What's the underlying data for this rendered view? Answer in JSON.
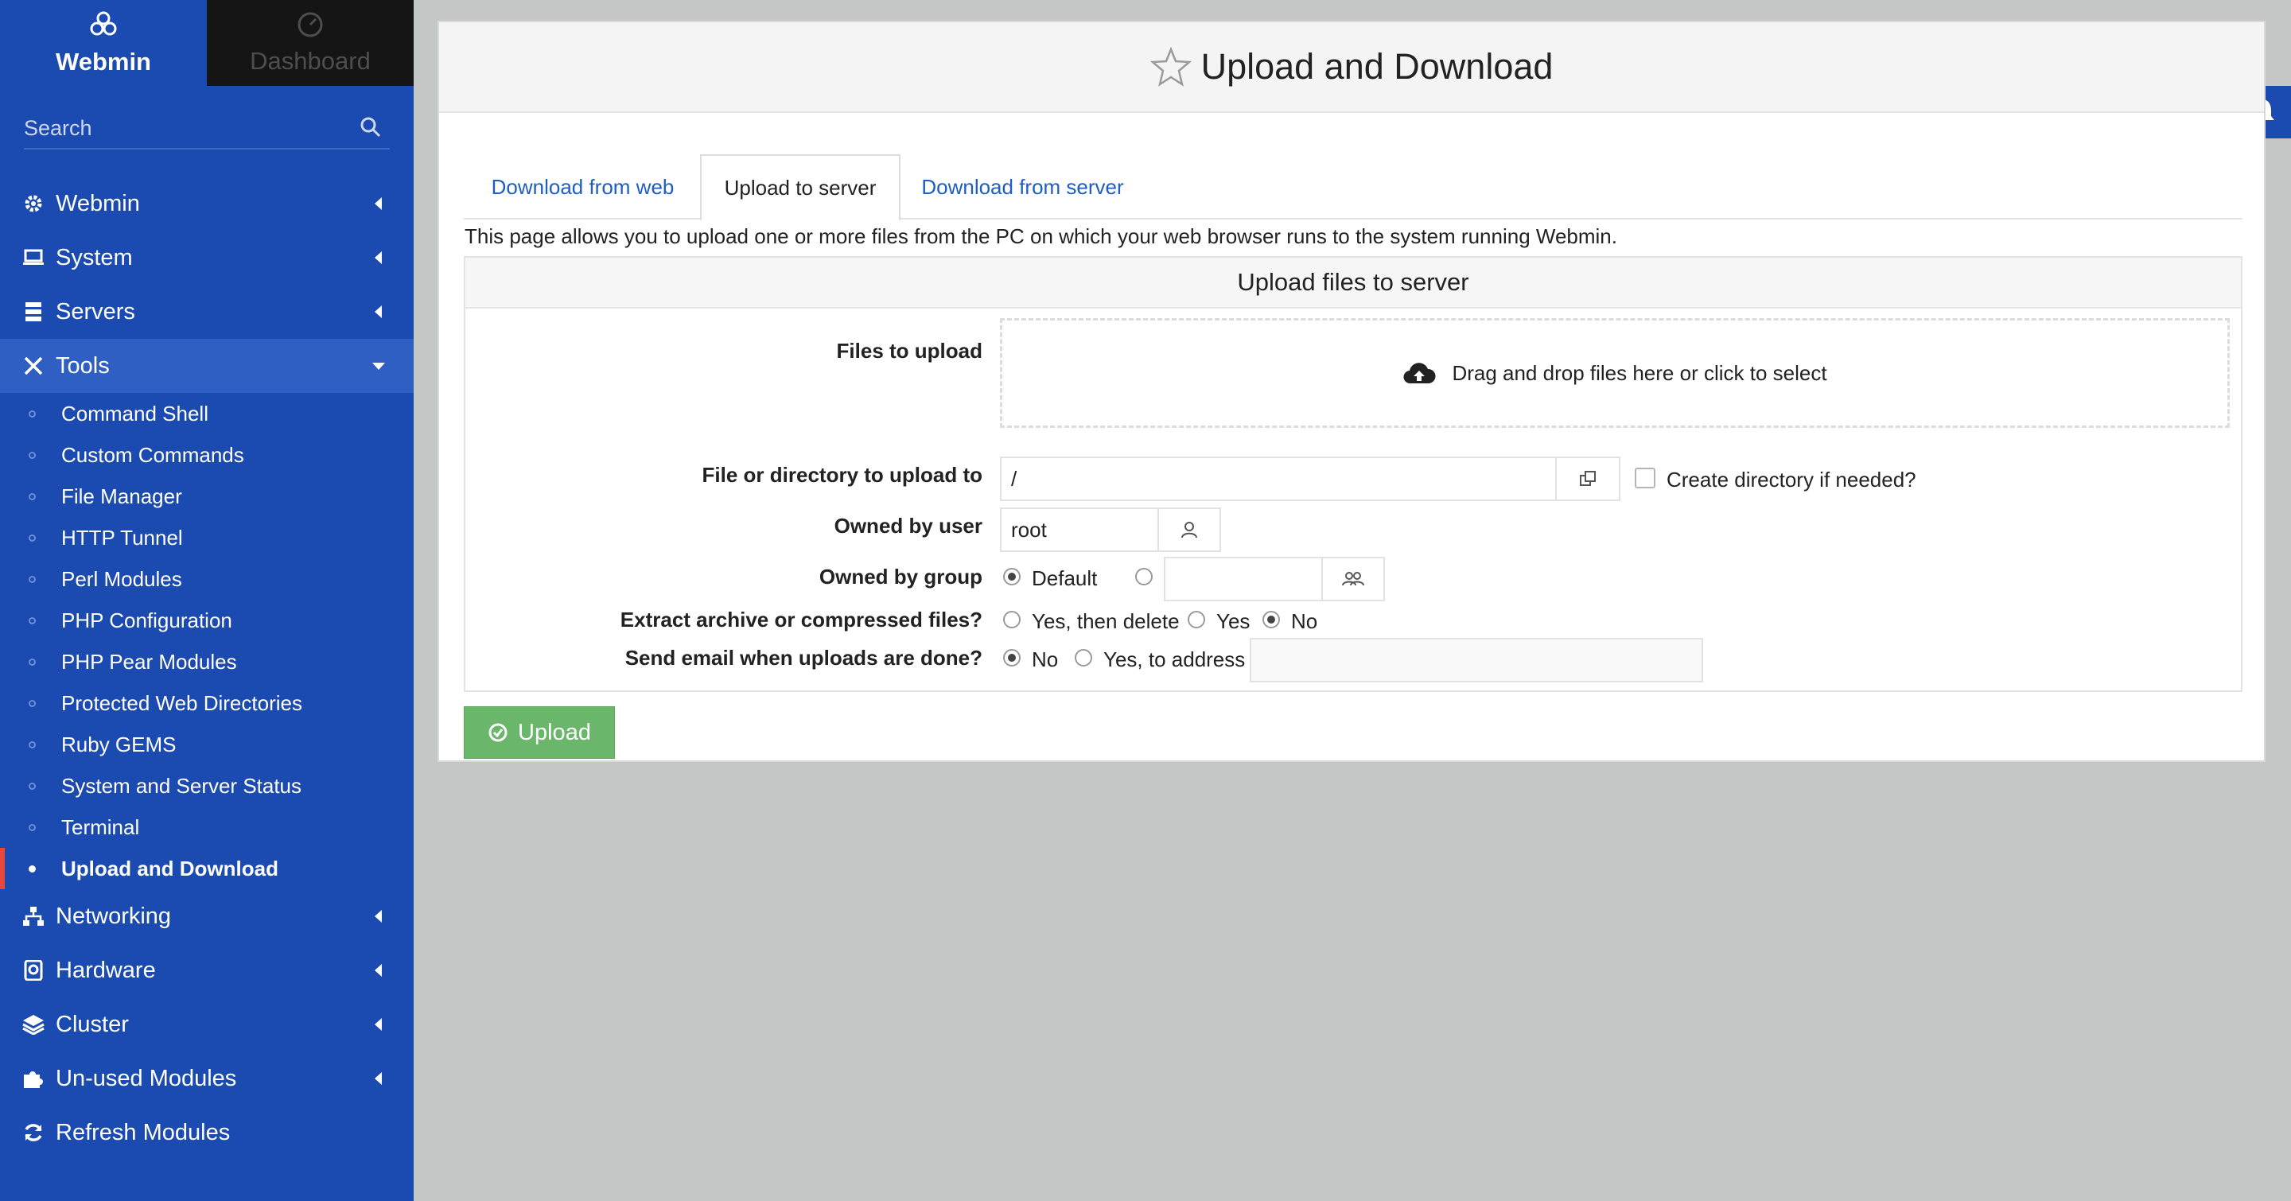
{
  "sidebar": {
    "brand": "Webmin",
    "dashboard": "Dashboard",
    "search_placeholder": "Search",
    "menu": [
      {
        "label": "Webmin",
        "icon": "gear-icon"
      },
      {
        "label": "System",
        "icon": "laptop-icon"
      },
      {
        "label": "Servers",
        "icon": "server-icon"
      },
      {
        "label": "Tools",
        "icon": "tools-icon"
      },
      {
        "label": "Networking",
        "icon": "network-icon"
      },
      {
        "label": "Hardware",
        "icon": "hardware-icon"
      },
      {
        "label": "Cluster",
        "icon": "layers-icon"
      },
      {
        "label": "Un-used Modules",
        "icon": "puzzle-icon"
      },
      {
        "label": "Refresh Modules",
        "icon": "refresh-icon"
      }
    ],
    "tools_sub": [
      "Command Shell",
      "Custom Commands",
      "File Manager",
      "HTTP Tunnel",
      "Perl Modules",
      "PHP Configuration",
      "PHP Pear Modules",
      "Protected Web Directories",
      "Ruby GEMS",
      "System and Server Status",
      "Terminal",
      "Upload and Download"
    ],
    "active_sub": "Upload and Download"
  },
  "page": {
    "title": "Upload and Download",
    "tabs": [
      "Download from web",
      "Upload to server",
      "Download from server"
    ],
    "active_tab": "Upload to server",
    "description": "This page allows you to upload one or more files from the PC on which your web browser runs to the system running Webmin."
  },
  "form": {
    "heading": "Upload files to server",
    "files_label": "Files to upload",
    "dropzone_text": "Drag and drop files here or click to select",
    "dest_label": "File or directory to upload to",
    "dest_value": "/",
    "create_dir_label": "Create directory if needed?",
    "owner_label": "Owned by user",
    "owner_value": "root",
    "group_label": "Owned by group",
    "group_default": "Default",
    "group_value": "",
    "extract_label": "Extract archive or compressed files?",
    "extract_options": [
      "Yes, then delete",
      "Yes",
      "No"
    ],
    "extract_selected": "No",
    "email_label": "Send email when uploads are done?",
    "email_options": [
      "No",
      "Yes, to address"
    ],
    "email_selected": "No",
    "email_value": "",
    "submit_label": "Upload"
  },
  "colors": {
    "sidebar": "#1b4bb0",
    "sidebar_open": "#2f5fc2",
    "active_marker": "#e8473c",
    "link": "#1c5ec4",
    "upload_button": "#6ab66a"
  }
}
